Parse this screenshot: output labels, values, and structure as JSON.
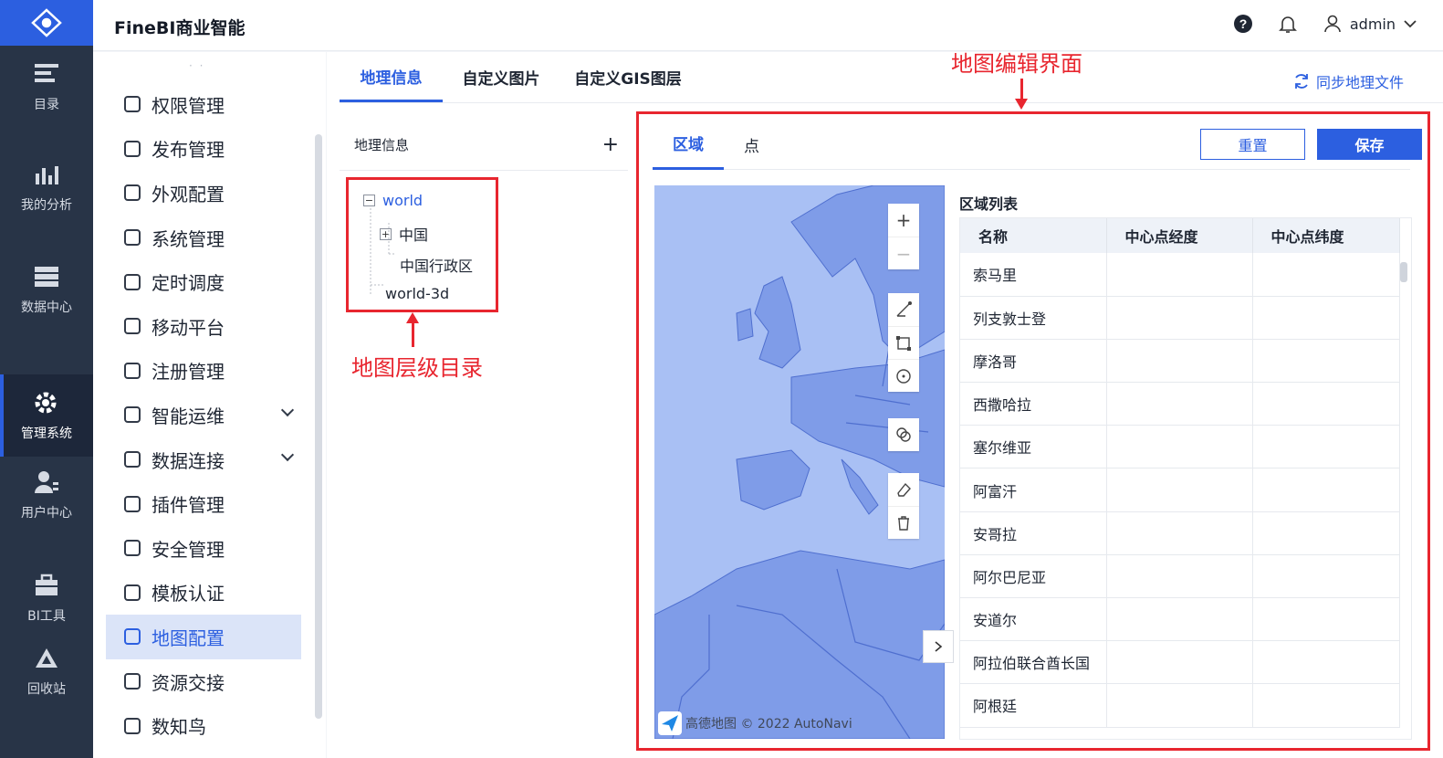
{
  "app": {
    "title": "FineBI商业智能",
    "user": "admin"
  },
  "leftnav": [
    {
      "label": "目录",
      "icon": "catalog-icon"
    },
    {
      "label": "我的分析",
      "icon": "analysis-icon"
    },
    {
      "label": "数据中心",
      "icon": "data-center-icon"
    },
    {
      "label": "管理系统",
      "icon": "gear-icon",
      "active": true
    },
    {
      "label": "用户中心",
      "icon": "user-icon"
    },
    {
      "label": "BI工具",
      "icon": "toolbox-icon"
    },
    {
      "label": "回收站",
      "icon": "recycle-icon"
    }
  ],
  "sidebar": {
    "items": [
      {
        "label": "权限管理"
      },
      {
        "label": "发布管理"
      },
      {
        "label": "外观配置"
      },
      {
        "label": "系统管理"
      },
      {
        "label": "定时调度"
      },
      {
        "label": "移动平台"
      },
      {
        "label": "注册管理"
      },
      {
        "label": "智能运维",
        "expandable": true
      },
      {
        "label": "数据连接",
        "expandable": true
      },
      {
        "label": "插件管理"
      },
      {
        "label": "安全管理"
      },
      {
        "label": "模板认证"
      },
      {
        "label": "地图配置",
        "active": true
      },
      {
        "label": "资源交接"
      },
      {
        "label": "数知鸟"
      }
    ]
  },
  "main": {
    "tabs": [
      {
        "label": "地理信息",
        "active": true
      },
      {
        "label": "自定义图片"
      },
      {
        "label": "自定义GIS图层"
      }
    ],
    "sync_label": "同步地理文件",
    "geo_panel": {
      "title": "地理信息",
      "tree": {
        "root": "world",
        "child1": "中国",
        "child2": "中国行政区",
        "root2": "world-3d"
      }
    },
    "editor": {
      "tabs": [
        {
          "label": "区域",
          "active": true
        },
        {
          "label": "点"
        }
      ],
      "reset_label": "重置",
      "save_label": "保存",
      "map_attribution": "高德地图 © 2022 AutoNavi",
      "region_list_title": "区域列表",
      "columns": [
        "名称",
        "中心点经度",
        "中心点纬度"
      ],
      "rows": [
        "索马里",
        "列支敦士登",
        "摩洛哥",
        "西撒哈拉",
        "塞尔维亚",
        "阿富汗",
        "安哥拉",
        "阿尔巴尼亚",
        "安道尔",
        "阿拉伯联合酋长国",
        "阿根廷"
      ]
    }
  },
  "annotations": {
    "map_editor": "地图编辑界面",
    "map_hierarchy": "地图层级目录"
  },
  "colors": {
    "accent": "#2c5fe0",
    "annotation": "#e8262f",
    "nav_bg": "#283447"
  }
}
